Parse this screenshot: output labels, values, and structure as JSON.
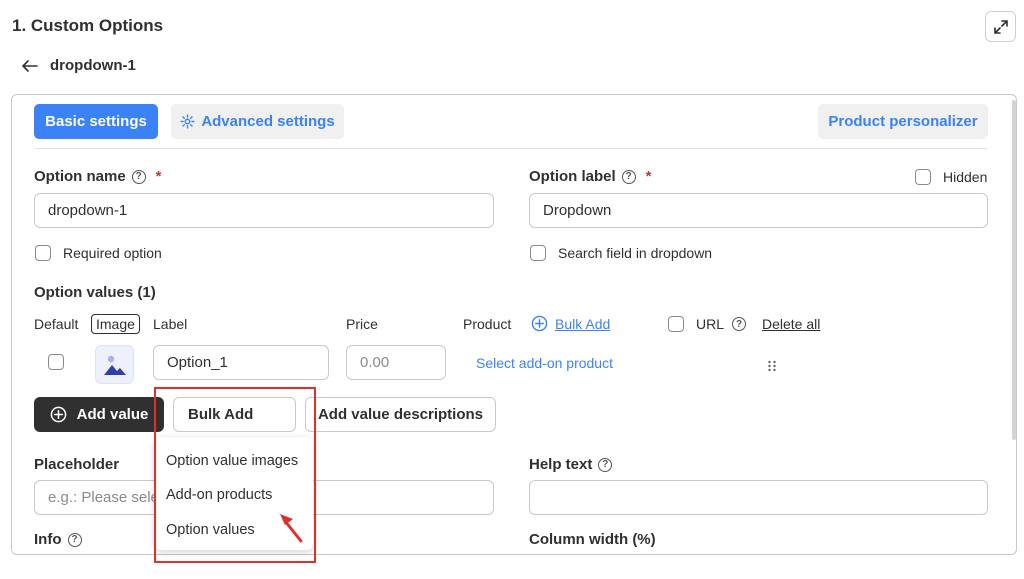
{
  "header": {
    "title": "1. Custom Options",
    "back_label": "dropdown-1"
  },
  "tabs": {
    "basic": "Basic settings",
    "advanced": "Advanced settings",
    "personalizer": "Product personalizer"
  },
  "option_name": {
    "label": "Option name",
    "required_mark": "*",
    "value": "dropdown-1"
  },
  "option_label": {
    "label": "Option label",
    "required_mark": "*",
    "value": "Dropdown",
    "hidden_label": "Hidden"
  },
  "checkboxes": {
    "required_option": "Required option",
    "search_field": "Search field in dropdown"
  },
  "option_values": {
    "heading": "Option values (1)",
    "columns": {
      "default": "Default",
      "image": "Image",
      "label": "Label",
      "price": "Price",
      "product": "Product",
      "bulk_add": "Bulk Add",
      "url": "URL",
      "delete_all": "Delete all"
    },
    "row": {
      "label_value": "Option_1",
      "price_placeholder": "0.00",
      "product_link": "Select add-on product"
    }
  },
  "actions": {
    "add_value": "Add value",
    "bulk_add": "Bulk Add",
    "add_descriptions": "Add value descriptions"
  },
  "dropdown_menu": {
    "items": [
      "Option value images",
      "Add-on products",
      "Option values"
    ]
  },
  "placeholder_field": {
    "label": "Placeholder",
    "placeholder": "e.g.: Please sele"
  },
  "help_text": {
    "label": "Help text"
  },
  "info": {
    "label": "Info"
  },
  "column_width": {
    "label": "Column width (%)"
  },
  "colors": {
    "primary": "#3b82f6",
    "dark_button": "#303030",
    "highlight": "#e0302b",
    "required": "#c0392b"
  }
}
